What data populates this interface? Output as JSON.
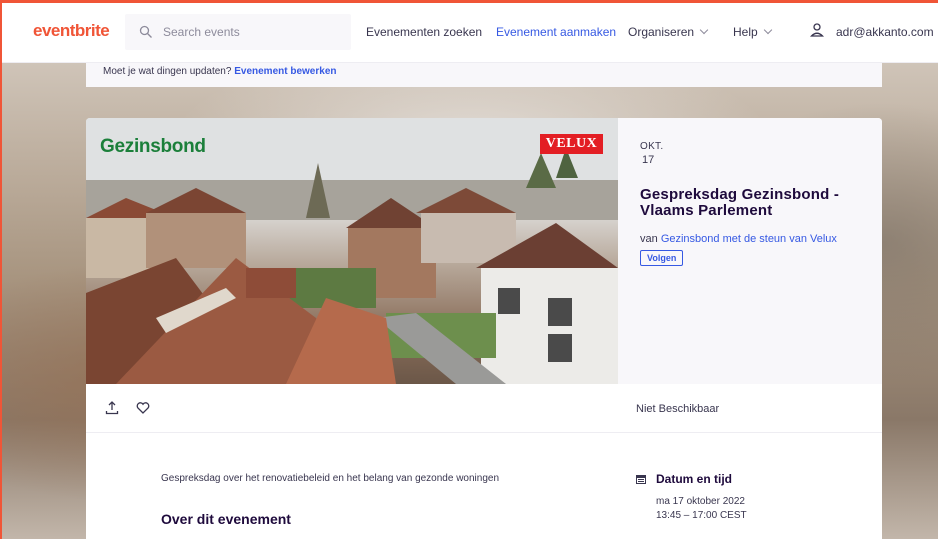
{
  "header": {
    "logo": "eventbrite",
    "search_placeholder": "Search events",
    "nav": {
      "find_events": "Evenementen zoeken",
      "create_event": "Evenement aanmaken",
      "organize": "Organiseren",
      "help": "Help",
      "account": "adr@akkanto.com"
    }
  },
  "update_bar": {
    "prompt": "Moet je wat dingen updaten?",
    "link": "Evenement bewerken"
  },
  "event": {
    "hero": {
      "logo_left": "Gezinsbond",
      "logo_right": "VELUX"
    },
    "month": "OKT.",
    "day": "17",
    "title": "Gespreksdag Gezinsbond - Vlaams Parlement",
    "by_prefix": "van",
    "organizer": "Gezinsbond met de steun van Velux",
    "follow_label": "Volgen",
    "ticket_status": "Niet Beschikbaar",
    "summary": "Gespreksdag over het renovatiebeleid en het belang van gezonde woningen",
    "about_heading": "Over dit evenement",
    "datetime": {
      "heading": "Datum en tijd",
      "date": "ma 17 oktober 2022",
      "time": "13:45 – 17:00 CEST"
    }
  },
  "colors": {
    "brand": "#f05537",
    "link": "#3659e3",
    "velux": "#e31e24",
    "gezinsbond": "#1b7f3a"
  },
  "icons": [
    "search-icon",
    "chevron-down-icon",
    "user-icon",
    "share-icon",
    "heart-icon",
    "calendar-icon"
  ]
}
